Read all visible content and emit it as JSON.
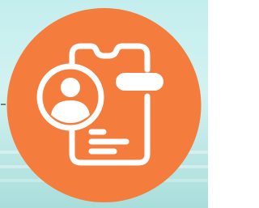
{
  "icon": {
    "name": "mobile-profile-icon",
    "badge_color": "#f47c3c",
    "stroke_color": "#ffffff",
    "background_color": "#c8eeee"
  }
}
